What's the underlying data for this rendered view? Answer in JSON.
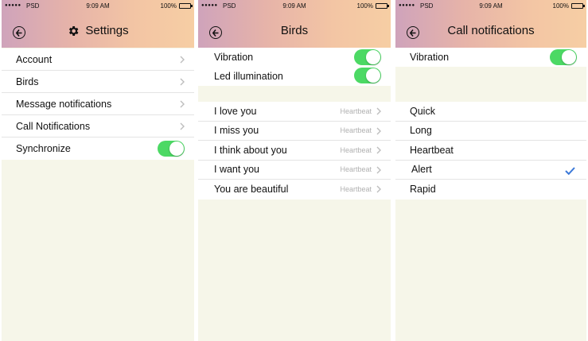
{
  "status_bar": {
    "carrier": "PSD",
    "time": "9:09 AM",
    "battery": "100%"
  },
  "screens": [
    {
      "title": "Settings",
      "items": [
        {
          "label": "Account"
        },
        {
          "label": "Birds"
        },
        {
          "label": "Message notifications"
        },
        {
          "label": "Call Notifications"
        },
        {
          "label": "Synchronize",
          "toggle": true
        }
      ]
    },
    {
      "title": "Birds",
      "toggles": [
        {
          "label": "Vibration",
          "on": true
        },
        {
          "label": "Led illumination",
          "on": true
        }
      ],
      "items": [
        {
          "label": "I love you",
          "value": "Heartbeat"
        },
        {
          "label": "I miss you",
          "value": "Heartbeat"
        },
        {
          "label": "I think about you",
          "value": "Heartbeat"
        },
        {
          "label": "I want you",
          "value": "Heartbeat"
        },
        {
          "label": "You are beautiful",
          "value": "Heartbeat"
        }
      ]
    },
    {
      "title": "Call notifications",
      "toggles": [
        {
          "label": "Vibration",
          "on": true
        }
      ],
      "options": [
        {
          "label": "Quick"
        },
        {
          "label": "Long"
        },
        {
          "label": "Heartbeat"
        },
        {
          "label": "Alert",
          "selected": true
        },
        {
          "label": "Rapid"
        }
      ]
    }
  ],
  "colors": {
    "header_gradient_start": "#cfa3bb",
    "header_gradient_end": "#f6cea4",
    "toggle_on": "#4cd964",
    "check": "#3a78d8",
    "background": "#f6f6e9"
  },
  "icons": [
    "signal-dots-icon",
    "battery-icon",
    "back-arrow-icon",
    "gear-icon",
    "chevron-right-icon",
    "checkmark-icon"
  ]
}
